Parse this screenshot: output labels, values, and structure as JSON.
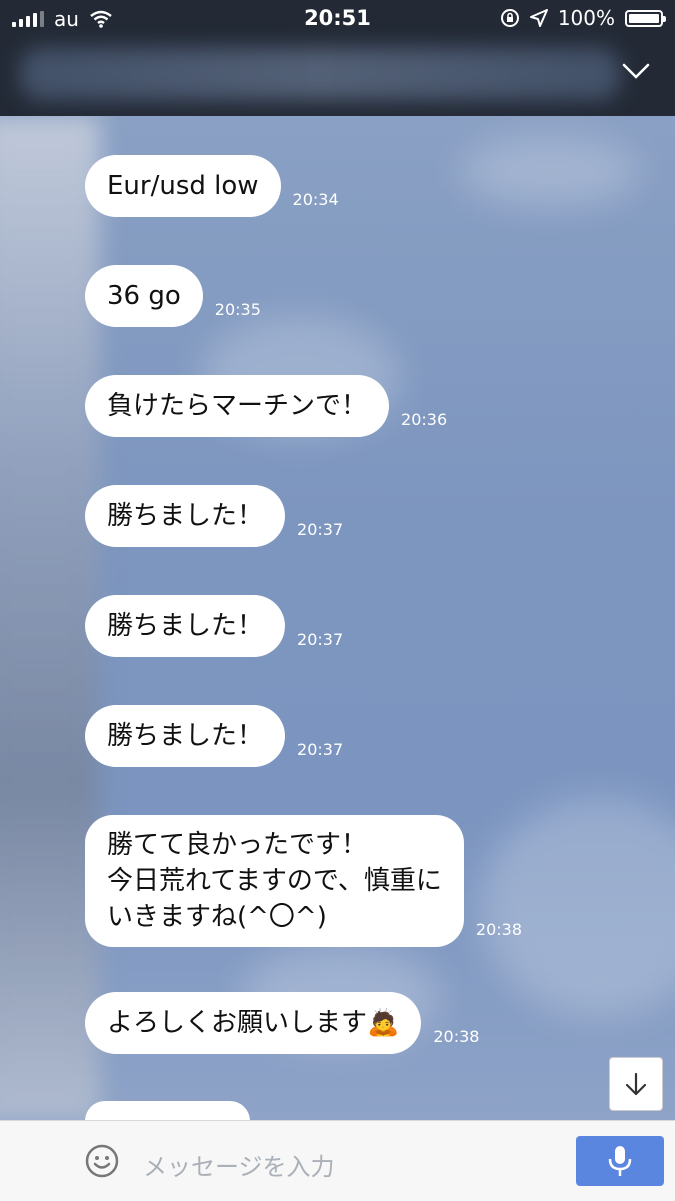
{
  "status_bar": {
    "carrier": "au",
    "time": "20:51",
    "battery": "100%",
    "battery_level": 1.0
  },
  "messages": [
    {
      "text": "Eur/usd low",
      "time": "20:34"
    },
    {
      "text": "36 go",
      "time": "20:35"
    },
    {
      "text": "負けたらマーチンで！",
      "time": "20:36"
    },
    {
      "text": "勝ちました！",
      "time": "20:37"
    },
    {
      "text": "勝ちました！",
      "time": "20:37"
    },
    {
      "text": "勝ちました！",
      "time": "20:37"
    },
    {
      "text": "勝てて良かったです！\n今日荒れてますので、慎重に\nいきますね(^〇^)",
      "time": "20:38"
    },
    {
      "text": "よろしくお願いします🙇",
      "time": "20:38"
    }
  ],
  "input": {
    "placeholder": "メッセージを入力"
  },
  "icons": {
    "signal": "signal-icon",
    "wifi": "wifi-icon",
    "lock_rotation": "lock-rotation-icon",
    "location": "location-arrow-icon",
    "chevron": "chevron-down-icon",
    "scroll_down": "arrow-down-icon",
    "emoji": "smiley-icon",
    "mic": "microphone-icon"
  },
  "colors": {
    "header_bg": "#232a36",
    "chat_bg": "#7f97bd",
    "bubble_bg": "#ffffff",
    "mic_button": "#5b86e0"
  }
}
